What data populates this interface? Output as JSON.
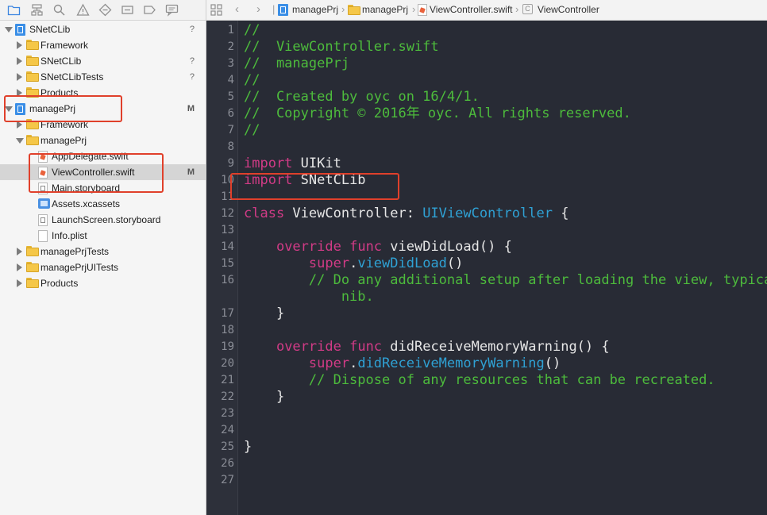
{
  "navigator": {
    "toolbar_icons": [
      "folder-icon",
      "hierarchy-icon",
      "search-icon",
      "warning-icon",
      "diamond-icon",
      "tag-icon",
      "breakpoint-icon",
      "comment-icon"
    ],
    "rows": [
      {
        "label": "SNetCLib",
        "icon": "project",
        "depth": 0,
        "disclosure": "open",
        "badge": "?"
      },
      {
        "label": "Framework",
        "icon": "folder",
        "depth": 1,
        "disclosure": "closed",
        "badge": ""
      },
      {
        "label": "SNetCLib",
        "icon": "folder",
        "depth": 1,
        "disclosure": "closed",
        "badge": "?"
      },
      {
        "label": "SNetCLibTests",
        "icon": "folder",
        "depth": 1,
        "disclosure": "closed",
        "badge": "?"
      },
      {
        "label": "Products",
        "icon": "folder",
        "depth": 1,
        "disclosure": "closed",
        "badge": ""
      },
      {
        "label": "managePrj",
        "icon": "project",
        "depth": 0,
        "disclosure": "open",
        "badge": "M"
      },
      {
        "label": "Framework",
        "icon": "folder",
        "depth": 1,
        "disclosure": "closed",
        "badge": ""
      },
      {
        "label": "managePrj",
        "icon": "folder",
        "depth": 1,
        "disclosure": "open",
        "badge": ""
      },
      {
        "label": "AppDelegate.swift",
        "icon": "swift",
        "depth": 2,
        "disclosure": "",
        "badge": ""
      },
      {
        "label": "ViewController.swift",
        "icon": "swift",
        "depth": 2,
        "disclosure": "",
        "badge": "M",
        "selected": true
      },
      {
        "label": "Main.storyboard",
        "icon": "storyboard",
        "depth": 2,
        "disclosure": "",
        "badge": ""
      },
      {
        "label": "Assets.xcassets",
        "icon": "assets",
        "depth": 2,
        "disclosure": "",
        "badge": ""
      },
      {
        "label": "LaunchScreen.storyboard",
        "icon": "storyboard",
        "depth": 2,
        "disclosure": "",
        "badge": ""
      },
      {
        "label": "Info.plist",
        "icon": "plist",
        "depth": 2,
        "disclosure": "",
        "badge": ""
      },
      {
        "label": "managePrjTests",
        "icon": "folder",
        "depth": 1,
        "disclosure": "closed",
        "badge": ""
      },
      {
        "label": "managePrjUITests",
        "icon": "folder",
        "depth": 1,
        "disclosure": "closed",
        "badge": ""
      },
      {
        "label": "Products",
        "icon": "folder",
        "depth": 1,
        "disclosure": "closed",
        "badge": ""
      }
    ]
  },
  "jump_bar": {
    "crumbs": [
      "managePrj",
      "managePrj",
      "ViewController.swift",
      "ViewController"
    ]
  },
  "editor": {
    "lines": [
      {
        "n": "1",
        "segs": [
          {
            "t": "//",
            "c": "cm"
          }
        ]
      },
      {
        "n": "2",
        "segs": [
          {
            "t": "//  ViewController.swift",
            "c": "cm"
          }
        ]
      },
      {
        "n": "3",
        "segs": [
          {
            "t": "//  managePrj",
            "c": "cm"
          }
        ]
      },
      {
        "n": "4",
        "segs": [
          {
            "t": "//",
            "c": "cm"
          }
        ]
      },
      {
        "n": "5",
        "segs": [
          {
            "t": "//  Created by oyc on 16/4/1.",
            "c": "cm"
          }
        ]
      },
      {
        "n": "6",
        "segs": [
          {
            "t": "//  Copyright © 2016年 oyc. All rights reserved.",
            "c": "cm"
          }
        ]
      },
      {
        "n": "7",
        "segs": [
          {
            "t": "//",
            "c": "cm"
          }
        ]
      },
      {
        "n": "8",
        "segs": []
      },
      {
        "n": "9",
        "segs": [
          {
            "t": "import",
            "c": "kw"
          },
          {
            "t": " UIKit",
            "c": ""
          }
        ]
      },
      {
        "n": "10",
        "segs": [
          {
            "t": "import",
            "c": "kw"
          },
          {
            "t": " SNetCLib",
            "c": ""
          }
        ]
      },
      {
        "n": "11",
        "segs": []
      },
      {
        "n": "12",
        "segs": [
          {
            "t": "class",
            "c": "kw"
          },
          {
            "t": " ViewController: ",
            "c": ""
          },
          {
            "t": "UIViewController",
            "c": "ty"
          },
          {
            "t": " {",
            "c": ""
          }
        ]
      },
      {
        "n": "13",
        "segs": []
      },
      {
        "n": "14",
        "segs": [
          {
            "t": "    ",
            "c": ""
          },
          {
            "t": "override",
            "c": "kw"
          },
          {
            "t": " ",
            "c": ""
          },
          {
            "t": "func",
            "c": "kw"
          },
          {
            "t": " viewDidLoad() {",
            "c": ""
          }
        ]
      },
      {
        "n": "15",
        "segs": [
          {
            "t": "        ",
            "c": ""
          },
          {
            "t": "super",
            "c": "kw"
          },
          {
            "t": ".",
            "c": ""
          },
          {
            "t": "viewDidLoad",
            "c": "ty"
          },
          {
            "t": "()",
            "c": ""
          }
        ]
      },
      {
        "n": "16",
        "segs": [
          {
            "t": "        // Do any additional setup after loading the view, typically from a",
            "c": "cm"
          }
        ]
      },
      {
        "n": "",
        "segs": [
          {
            "t": "            nib.",
            "c": "cm"
          }
        ]
      },
      {
        "n": "17",
        "segs": [
          {
            "t": "    }",
            "c": ""
          }
        ]
      },
      {
        "n": "18",
        "segs": []
      },
      {
        "n": "19",
        "segs": [
          {
            "t": "    ",
            "c": ""
          },
          {
            "t": "override",
            "c": "kw"
          },
          {
            "t": " ",
            "c": ""
          },
          {
            "t": "func",
            "c": "kw"
          },
          {
            "t": " didReceiveMemoryWarning() {",
            "c": ""
          }
        ]
      },
      {
        "n": "20",
        "segs": [
          {
            "t": "        ",
            "c": ""
          },
          {
            "t": "super",
            "c": "kw"
          },
          {
            "t": ".",
            "c": ""
          },
          {
            "t": "didReceiveMemoryWarning",
            "c": "ty"
          },
          {
            "t": "()",
            "c": ""
          }
        ]
      },
      {
        "n": "21",
        "segs": [
          {
            "t": "        // Dispose of any resources that can be recreated.",
            "c": "cm"
          }
        ]
      },
      {
        "n": "22",
        "segs": [
          {
            "t": "    }",
            "c": ""
          }
        ]
      },
      {
        "n": "23",
        "segs": []
      },
      {
        "n": "24",
        "segs": []
      },
      {
        "n": "25",
        "segs": [
          {
            "t": "}",
            "c": ""
          }
        ]
      },
      {
        "n": "26",
        "segs": []
      },
      {
        "n": "27",
        "segs": []
      }
    ]
  },
  "colors": {
    "editor_bg": "#282b35",
    "comment": "#4dbb3c",
    "keyword": "#d13b86",
    "type": "#2fa1d4",
    "annotation": "#e0402b"
  }
}
